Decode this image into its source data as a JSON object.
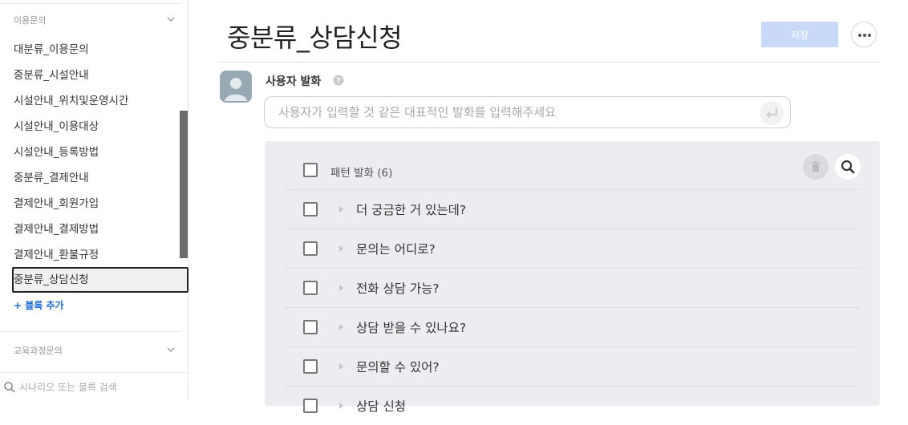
{
  "sidebar": {
    "groups": [
      {
        "label": "이용문의"
      },
      {
        "label": "교육과정문의"
      }
    ],
    "items": [
      {
        "label": "대분류_이용문의"
      },
      {
        "label": "중분류_시설안내"
      },
      {
        "label": "시설안내_위치및운영시간"
      },
      {
        "label": "시설안내_이용대상"
      },
      {
        "label": "시설안내_등록방법"
      },
      {
        "label": "중분류_결제안내"
      },
      {
        "label": "결제안내_회원가입"
      },
      {
        "label": "결제안내_결제방법"
      },
      {
        "label": "결제안내_환불규정"
      },
      {
        "label": "중분류_상담신청"
      }
    ],
    "active_item": "중분류_상담신청",
    "add_block_label": "+ 블록 추가",
    "search": {
      "placeholder": "시나리오 또는 블록 검색",
      "value": ""
    }
  },
  "main": {
    "title": "중분류_상담신청",
    "save_label": "저장",
    "user_utterance": {
      "label": "사용자 발화",
      "placeholder": "사용자가 입력할 것 같은 대표적인 발화를 입력해주세요",
      "value": ""
    },
    "patterns": {
      "header_label": "패턴 발화 (6)",
      "items": [
        {
          "text": "더 궁금한 거 있는데?"
        },
        {
          "text": "문의는 어디로?"
        },
        {
          "text": "전화 상담 가능?"
        },
        {
          "text": "상담 받을 수 있나요?"
        },
        {
          "text": "문의할 수 있어?"
        },
        {
          "text": "상담 신청"
        }
      ]
    }
  },
  "colors": {
    "accent": "#1e6ad8",
    "save_disabled": "#c8daf8",
    "panel_bg": "#ececf1",
    "avatar": "#97a9b3"
  },
  "icons": [
    "chevron-down-icon",
    "search-icon",
    "help-icon",
    "more-icon",
    "enter-icon",
    "trash-icon",
    "caret-right-icon",
    "user-avatar-icon"
  ]
}
